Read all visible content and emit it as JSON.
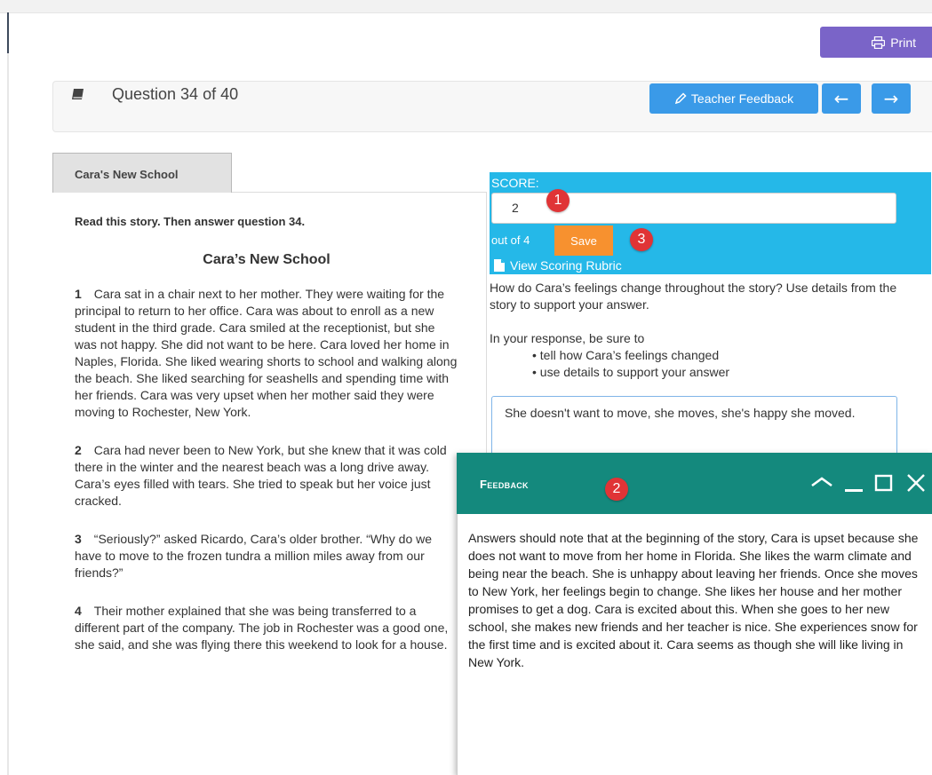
{
  "toolbar": {
    "print_label": "Print"
  },
  "question_bar": {
    "label": "Question 34 of 40",
    "teacher_feedback_label": "Teacher Feedback",
    "prev_arrow": "←",
    "next_arrow": "→"
  },
  "passage": {
    "tab_label": "Cara's New School",
    "instruction": "Read this story. Then answer question 34.",
    "title": "Cara’s New School",
    "paragraphs": [
      {
        "num": "1",
        "text": "Cara sat in a chair next to her mother. They were waiting for the principal to return to her office. Cara was about to enroll as a new student in the third grade. Cara smiled at the receptionist, but she was not happy. She did not want to be here. Cara loved her home in Naples, Florida. She liked wearing shorts to school and walking along the beach. She liked searching for seashells and spending time with her friends. Cara was very upset when her mother said they were moving to Rochester, New York."
      },
      {
        "num": "2",
        "text": "Cara had never been to New York, but she knew that it was cold there in the winter and the nearest beach was a long drive away. Cara’s eyes filled with tears. She tried to speak but her voice just cracked."
      },
      {
        "num": "3",
        "text": "“Seriously?” asked Ricardo, Cara’s older brother. “Why do we have to move to the frozen tundra a million miles away from our friends?”"
      },
      {
        "num": "4",
        "text": "Their mother explained that she was being transferred to a different part of the company. The job in Rochester was a good one, she said, and she was flying there this weekend to look for a house."
      }
    ]
  },
  "scoring": {
    "label": "SCORE:",
    "value": "2",
    "out_of": "out of 4",
    "save_label": "Save",
    "rubric_label": "View Scoring Rubric"
  },
  "badges": {
    "one": "1",
    "two": "2",
    "three": "3"
  },
  "prompt": {
    "question": "How do Cara’s feelings change throughout the story? Use details from the story to support your answer.",
    "intro": "In your response, be sure to",
    "bullets": [
      "tell how Cara’s feelings changed",
      "use details to support your answer"
    ]
  },
  "answer": {
    "text": "She doesn't want to move, she moves, she's happy she moved."
  },
  "feedback": {
    "title": "Feedback",
    "body": "Answers should note that at the beginning of the story, Cara is upset because she does not want to move from her home in Florida. She likes the warm climate and being near the beach. She is unhappy about leaving her friends. Once she moves to New York, her feelings begin to change. She likes her house and her mother promises to get a dog. Cara is excited about this. When she goes to her new school, she makes new friends and her teacher is nice. She experiences snow for the first time and is excited about it. Cara seems as though she will like living in New York."
  },
  "colors": {
    "accent_blue": "#3a9ae8",
    "score_cyan": "#25b8e8",
    "save_orange": "#f7912f",
    "print_purple": "#7a64c8",
    "feedback_teal": "#14897d",
    "badge_red": "#e03436"
  },
  "icons": [
    "printer-icon",
    "book-icon",
    "pencil-icon",
    "arrow-left-icon",
    "arrow-right-icon",
    "file-icon",
    "chevron-up-icon",
    "minimize-icon",
    "maximize-icon",
    "close-icon"
  ]
}
